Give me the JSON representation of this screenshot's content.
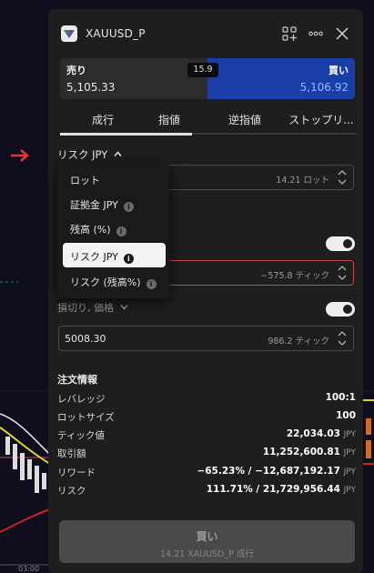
{
  "header": {
    "symbol": "XAUUSD_P"
  },
  "quote": {
    "sell_label": "売り",
    "sell_price": "5,105.33",
    "buy_label": "買い",
    "buy_price": "5,106.92",
    "spread": "15.9"
  },
  "tabs": [
    "成行",
    "指値",
    "逆指値",
    "ストップリ..."
  ],
  "risk_selector": "リスク JPY",
  "lot_field": {
    "unit": "14.21 ロット"
  },
  "tp_field": {
    "unit": "−575.8 ティック"
  },
  "stop_loss": {
    "label": "損切り, 価格",
    "value": "5008.30",
    "unit": "986.2 ティック"
  },
  "dropdown": {
    "items": [
      {
        "label": "ロット",
        "info": false
      },
      {
        "label": "証拠金 JPY",
        "info": true
      },
      {
        "label": "残高 (%)",
        "info": true
      },
      {
        "label": "リスク JPY",
        "info": true,
        "selected": true
      },
      {
        "label": "リスク (残高%)",
        "info": true
      }
    ],
    "info_glyph": "i"
  },
  "order_info": {
    "title": "注文情報",
    "rows": [
      {
        "key": "レバレッジ",
        "value": "100:1",
        "unit": ""
      },
      {
        "key": "ロットサイズ",
        "value": "100",
        "unit": ""
      },
      {
        "key": "ティック値",
        "value": "22,034.03",
        "unit": "JPY"
      },
      {
        "key": "取引額",
        "value": "11,252,600.81",
        "unit": "JPY"
      },
      {
        "key": "リワード",
        "value": "−65.23% / −12,687,192.17",
        "unit": "JPY"
      },
      {
        "key": "リスク",
        "value": "111.71% / 21,729,956.44",
        "unit": "JPY"
      }
    ]
  },
  "buy_button": {
    "label": "買い",
    "sub": "14.21 XAUUSD_P 成行"
  },
  "chart_bg": {
    "axis_label": "03:00"
  },
  "colors": {
    "buy_blue": "#1a3ea8",
    "error_red": "#c64650",
    "arrow_red": "#e8323c"
  }
}
